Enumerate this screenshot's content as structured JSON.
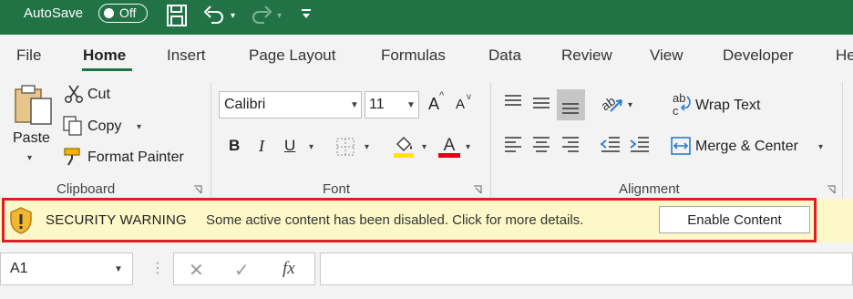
{
  "titlebar": {
    "autosave_label": "AutoSave",
    "autosave_state": "Off",
    "accent_color": "#217346"
  },
  "tabs": [
    {
      "label": "File"
    },
    {
      "label": "Home"
    },
    {
      "label": "Insert"
    },
    {
      "label": "Page Layout"
    },
    {
      "label": "Formulas"
    },
    {
      "label": "Data"
    },
    {
      "label": "Review"
    },
    {
      "label": "View"
    },
    {
      "label": "Developer"
    },
    {
      "label": "He"
    }
  ],
  "active_tab": "Home",
  "clipboard": {
    "paste": "Paste",
    "cut": "Cut",
    "copy": "Copy",
    "format_painter": "Format Painter",
    "group_label": "Clipboard"
  },
  "font": {
    "font_name": "Calibri",
    "font_size": "11",
    "bold": "B",
    "italic": "I",
    "underline": "U",
    "grow": "A",
    "shrink": "A",
    "font_color_glyph": "A",
    "group_label": "Font",
    "highlight_color": "#ffe600",
    "font_color": "#e0001b"
  },
  "alignment": {
    "wrap_text": "Wrap Text",
    "merge_center": "Merge & Center",
    "group_label": "Alignment"
  },
  "security_bar": {
    "title": "SECURITY WARNING",
    "message": "Some active content has been disabled. Click for more details.",
    "button_label": "Enable Content",
    "border_color": "#e01c24",
    "background": "#fcf8c8"
  },
  "formula_bar": {
    "name_box": "A1",
    "fx": "fx",
    "value": ""
  }
}
